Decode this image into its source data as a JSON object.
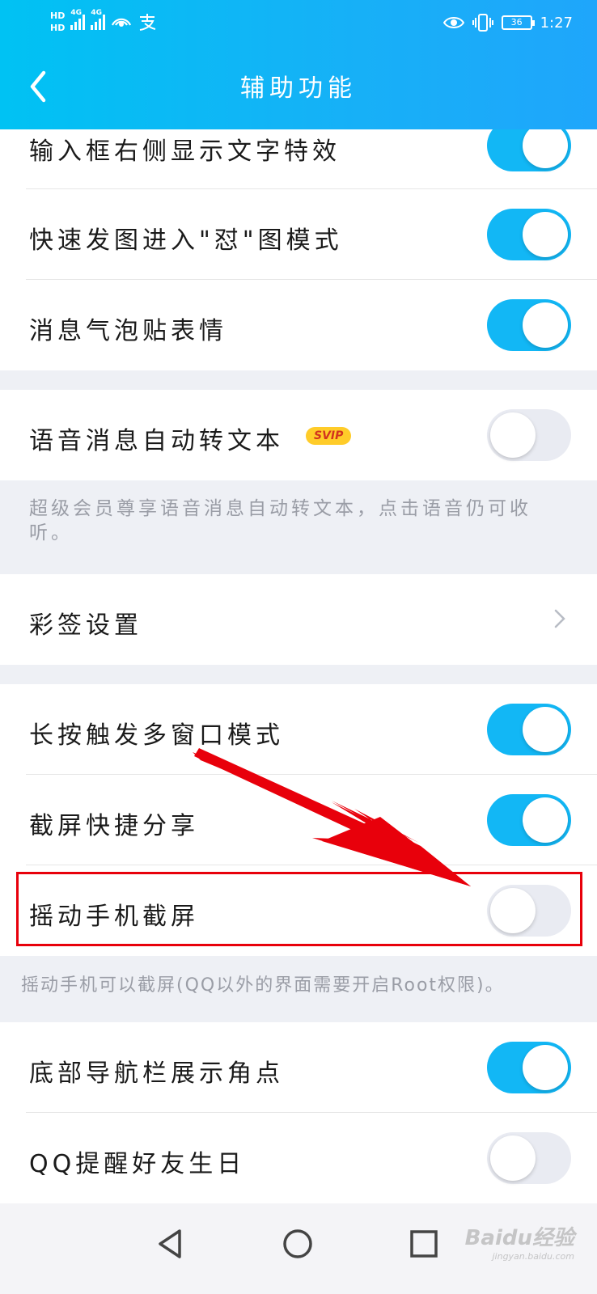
{
  "status_bar": {
    "hd1": "HD",
    "hd2": "HD",
    "sig1": "4G",
    "sig2": "4G",
    "battery": "36",
    "time": "1:27"
  },
  "header": {
    "title": "辅助功能"
  },
  "rows": {
    "input_effect": {
      "label": "输入框右侧显示文字特效",
      "on": true
    },
    "fast_image": {
      "label": "快速发图进入\"怼\"图模式",
      "on": true
    },
    "bubble_sticker": {
      "label": "消息气泡贴表情",
      "on": true
    },
    "voice_to_text": {
      "label": "语音消息自动转文本",
      "badge": "SVIP",
      "on": false
    },
    "tag_settings": {
      "label": "彩签设置"
    },
    "multi_window": {
      "label": "长按触发多窗口模式",
      "on": true
    },
    "screenshot_share": {
      "label": "截屏快捷分享",
      "on": true
    },
    "shake_screenshot": {
      "label": "摇动手机截屏",
      "on": false
    },
    "nav_dot": {
      "label": "底部导航栏展示角点",
      "on": true
    },
    "birthday": {
      "label": "QQ提醒好友生日",
      "on": false
    }
  },
  "notes": {
    "voice_note": "超级会员尊享语音消息自动转文本，点击语音仍可收听。",
    "shake_note": "摇动手机可以截屏(QQ以外的界面需要开启Root权限)。"
  },
  "watermark": {
    "brand": "Baidu经验",
    "url": "jingyan.baidu.com"
  },
  "colors": {
    "accent": "#12b7f5",
    "header": "#17b0f7",
    "highlight": "#e8000b"
  }
}
